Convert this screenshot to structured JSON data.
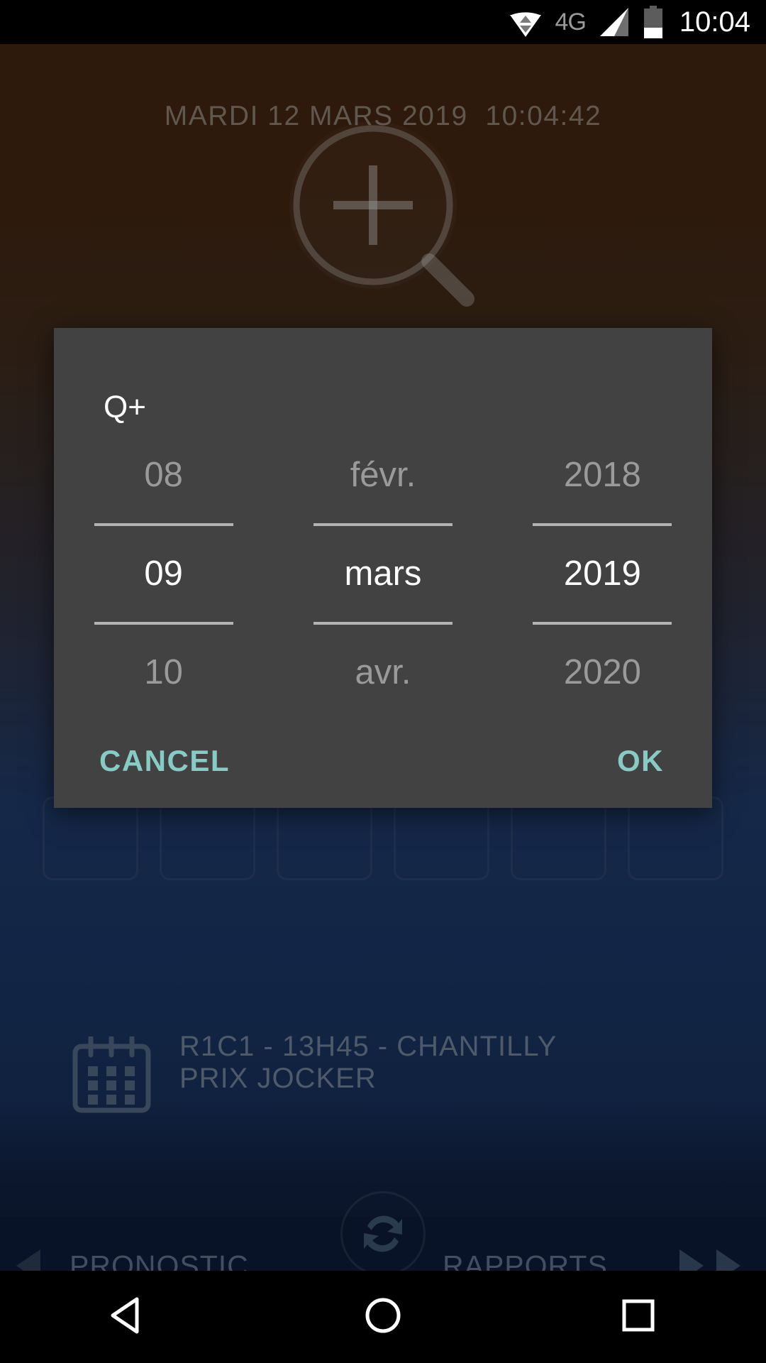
{
  "statusbar": {
    "network_label": "4G",
    "clock": "10:04",
    "icons": {
      "data_transfer": "data-transfer-icon",
      "signal": "signal-bars-icon",
      "battery": "battery-low-icon"
    }
  },
  "background": {
    "date_time_header": "MARDI 12 MARS 2019  10:04:42",
    "search_icon": "magnifier-plus-icon",
    "race": {
      "calendar_icon": "calendar-icon",
      "line1": "R1C1 - 13H45 - CHANTILLY",
      "line2": "PRIX JOCKER"
    },
    "tabbar": {
      "left_arrow": "chevron-left-icon",
      "prev_tab": "PRONOSTIC",
      "refresh_icon": "refresh-icon",
      "next_tab": "RAPPORTS",
      "right_arrow": "chevron-right-icon"
    }
  },
  "dialog": {
    "title": "Q+",
    "picker": {
      "day": {
        "previous": "08",
        "selected": "09",
        "next": "10"
      },
      "month": {
        "previous": "févr.",
        "selected": "mars",
        "next": "avr."
      },
      "year": {
        "previous": "2018",
        "selected": "2019",
        "next": "2020"
      }
    },
    "cancel_label": "CANCEL",
    "ok_label": "OK",
    "accent_color": "#86ccc4",
    "surface_color": "#424242"
  },
  "navbar": {
    "back": "back-triangle-icon",
    "home": "home-circle-icon",
    "recents": "recents-square-icon"
  }
}
